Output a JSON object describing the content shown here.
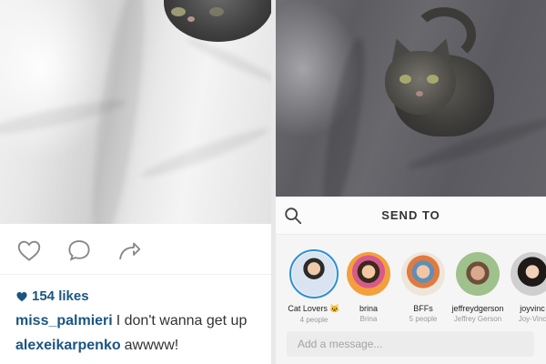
{
  "feed_post": {
    "likes_text": "154 likes",
    "like_icon": "heart-outline-icon",
    "comment_icon": "comment-bubble-icon",
    "share_icon": "share-arrow-icon",
    "likes_heart_icon": "heart-filled-icon",
    "comments": [
      {
        "user": "miss_palmieri",
        "text": "I don't wanna get up"
      },
      {
        "user": "alexeikarpenko",
        "text": "awwww!"
      }
    ]
  },
  "send_panel": {
    "title": "SEND TO",
    "search_icon": "search-icon",
    "recipients": [
      {
        "name": "Cat Lovers 🐱",
        "subtitle": "4 people",
        "selected": true
      },
      {
        "name": "brina",
        "subtitle": "Brina"
      },
      {
        "name": "BFFs",
        "subtitle": "5 people"
      },
      {
        "name": "jeffreydgerson",
        "subtitle": "Jeffrey Gerson"
      },
      {
        "name": "joyvinc",
        "subtitle": "Joy-Vinc"
      }
    ],
    "message_placeholder": "Add a message..."
  },
  "colors": {
    "username_blue": "#1b5583",
    "selected_ring": "#2f8fd8"
  }
}
